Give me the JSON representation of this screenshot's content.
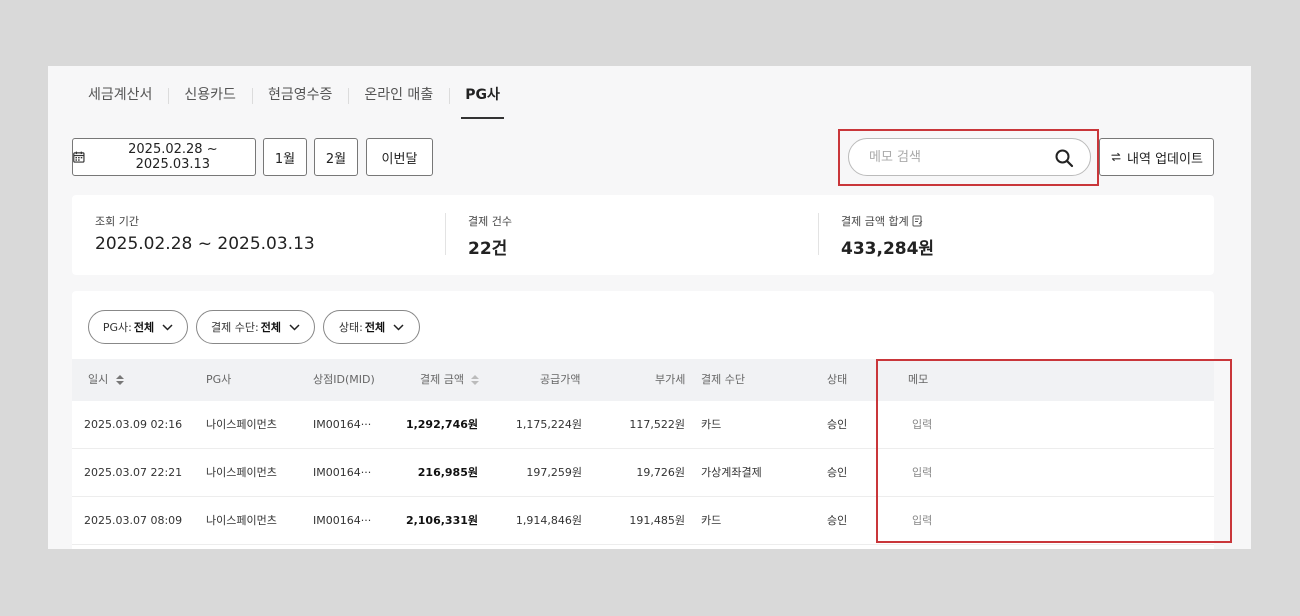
{
  "tabs": [
    {
      "label": "세금계산서",
      "active": false
    },
    {
      "label": "신용카드",
      "active": false
    },
    {
      "label": "현금영수증",
      "active": false
    },
    {
      "label": "온라인 매출",
      "active": false
    },
    {
      "label": "PG사",
      "active": true
    }
  ],
  "toolbar": {
    "date_range": "2025.02.28 ~ 2025.03.13",
    "month1": "1월",
    "month2": "2월",
    "this_month": "이번달",
    "search_placeholder": "메모 검색",
    "search_value": "",
    "update_label": "내역 업데이트"
  },
  "summary": {
    "period_label": "조회 기간",
    "period_value": "2025.02.28 ~ 2025.03.13",
    "count_label": "결제 건수",
    "count_value": "22건",
    "total_label": "결제 금액 합계",
    "total_value": "433,284원"
  },
  "filters": [
    {
      "label": "PG사:",
      "value": "전체"
    },
    {
      "label": "결제 수단:",
      "value": "전체"
    },
    {
      "label": "상태:",
      "value": "전체"
    }
  ],
  "table": {
    "headers": [
      "일시",
      "PG사",
      "상점ID(MID)",
      "결제 금액",
      "공급가액",
      "부가세",
      "결제 수단",
      "상태",
      "메모"
    ],
    "rows": [
      [
        "2025.03.09 02:16",
        "나이스페이먼츠",
        "IM00164···",
        "1,292,746원",
        "1,175,224원",
        "117,522원",
        "카드",
        "승인",
        "입력"
      ],
      [
        "2025.03.07 22:21",
        "나이스페이먼츠",
        "IM00164···",
        "216,985원",
        "197,259원",
        "19,726원",
        "가상계좌결제",
        "승인",
        "입력"
      ],
      [
        "2025.03.07 08:09",
        "나이스페이먼츠",
        "IM00164···",
        "2,106,331원",
        "1,914,846원",
        "191,485원",
        "카드",
        "승인",
        "입력"
      ]
    ]
  },
  "colors": {
    "highlight": "#c9363a",
    "header_bg": "#f1f2f4"
  }
}
